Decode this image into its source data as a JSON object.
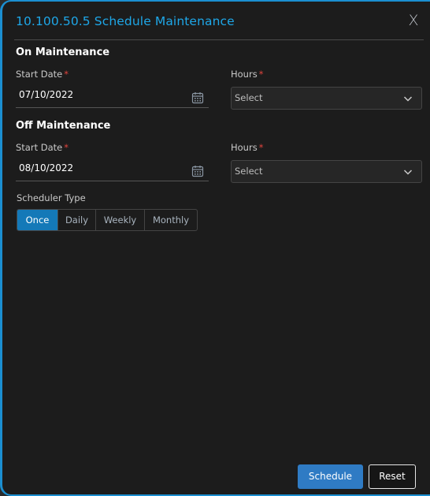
{
  "dialog": {
    "title": "10.100.50.5 Schedule Maintenance",
    "close_label": "X"
  },
  "on_maintenance": {
    "heading": "On Maintenance",
    "start_date_label": "Start Date",
    "start_date_value": "07/10/2022",
    "hours_label": "Hours",
    "hours_value": "Select"
  },
  "off_maintenance": {
    "heading": "Off Maintenance",
    "start_date_label": "Start Date",
    "start_date_value": "08/10/2022",
    "hours_label": "Hours",
    "hours_value": "Select"
  },
  "required_marker": "*",
  "scheduler": {
    "label": "Scheduler Type",
    "options": [
      "Once",
      "Daily",
      "Weekly",
      "Monthly"
    ],
    "selected": "Once"
  },
  "actions": {
    "schedule_label": "Schedule",
    "reset_label": "Reset"
  },
  "colors": {
    "accent": "#1ea7e8",
    "required": "#e0443e",
    "primary_button": "#2f7bc4",
    "active_tab": "#1479b8"
  }
}
